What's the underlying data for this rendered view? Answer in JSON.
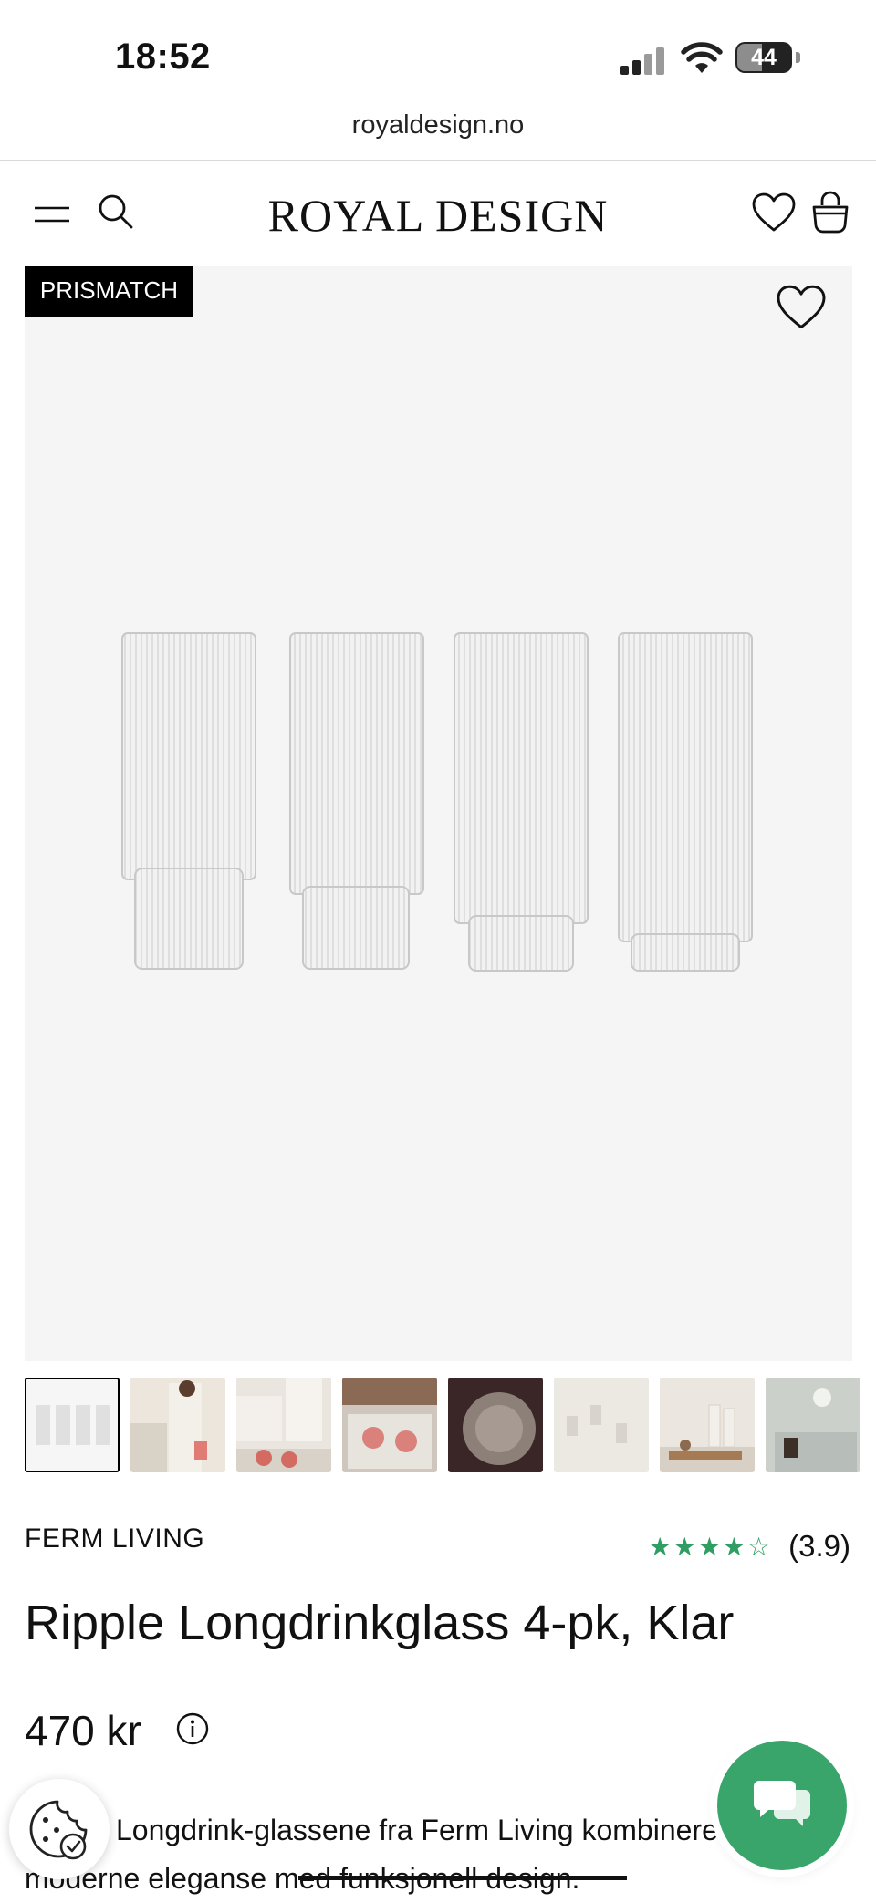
{
  "status_bar": {
    "time": "18:52",
    "battery": "44"
  },
  "browser": {
    "url": "royaldesign.no"
  },
  "header": {
    "logo": "ROYAL DESIGN"
  },
  "gallery": {
    "badge": "PRISMATCH",
    "thumbnail_count": 8,
    "active_thumbnail": 1
  },
  "product": {
    "brand": "FERM LIVING",
    "rating": "(3.9)",
    "rating_value": 3.9,
    "stars_display": "★★★★☆",
    "title": "Ripple Longdrinkglass 4-pk, Klar",
    "price": "470 kr",
    "description_line1": "Longdrink-glassene fra Ferm Living kombinerer",
    "description_line2": "moderne eleganse med funksjonell design."
  },
  "colors": {
    "accent_green": "#3aa56b",
    "star_green": "#2e9e62",
    "badge_black": "#000000"
  }
}
